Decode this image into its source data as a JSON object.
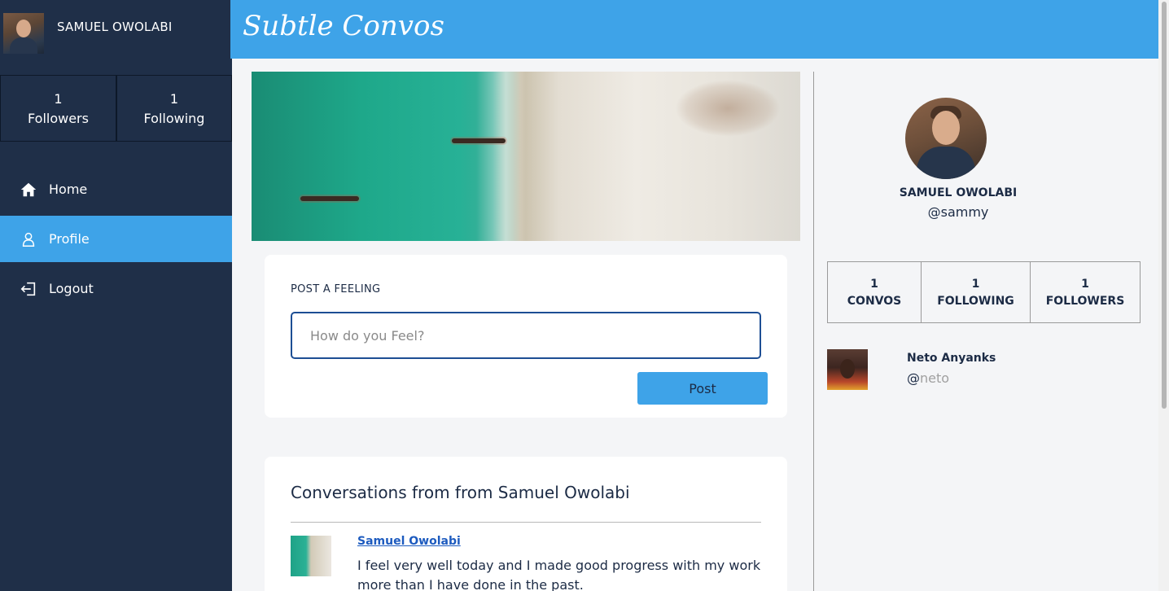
{
  "sidebar": {
    "user_name": "SAMUEL OWOLABI",
    "stats": [
      {
        "count": "1",
        "label": "Followers"
      },
      {
        "count": "1",
        "label": "Following"
      }
    ],
    "nav": [
      {
        "label": "Home",
        "icon": "home-icon"
      },
      {
        "label": "Profile",
        "icon": "user-icon",
        "active": true
      },
      {
        "label": "Logout",
        "icon": "logout-icon"
      }
    ]
  },
  "header": {
    "title": "Subtle Convos"
  },
  "post": {
    "label": "POST A FEELING",
    "placeholder": "How do you Feel?",
    "button_label": "Post"
  },
  "conversations": {
    "title": "Conversations from from Samuel Owolabi",
    "items": [
      {
        "author": "Samuel Owolabi",
        "text": "I feel very well today and I made good progress with my work more than I have done in the past."
      }
    ]
  },
  "profile": {
    "name": "SAMUEL OWOLABI",
    "handle": "@sammy",
    "stats": [
      {
        "count": "1",
        "label": "CONVOS"
      },
      {
        "count": "1",
        "label": "FOLLOWING"
      },
      {
        "count": "1",
        "label": "FOLLOWERS"
      }
    ]
  },
  "suggestion": {
    "name": "Neto Anyanks",
    "handle_at": "@",
    "handle_name": "neto"
  },
  "colors": {
    "sidebar_bg": "#1f2f48",
    "accent": "#3ea3e8",
    "link": "#1d5bbf",
    "input_border": "#1d4e94"
  }
}
